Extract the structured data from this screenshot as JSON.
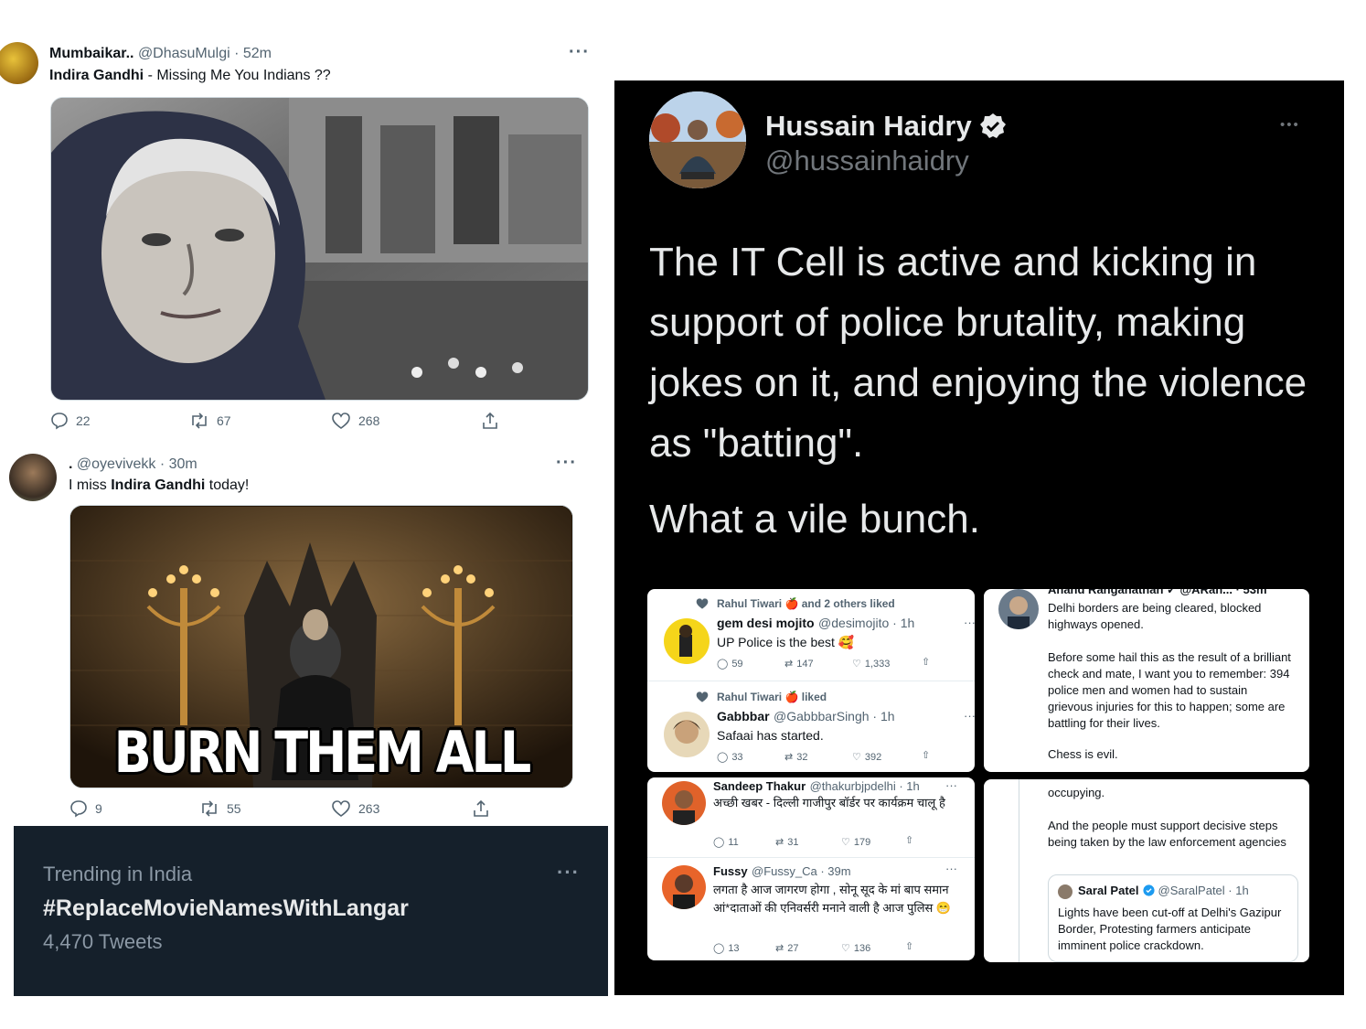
{
  "left": {
    "tweet1": {
      "name": "Mumbaikar..",
      "handle": "@DhasuMulgi · 52m",
      "text_bold": "Indira Gandhi",
      "text_rest": " - Missing Me You Indians ??",
      "replies": "22",
      "retweets": "67",
      "likes": "268"
    },
    "tweet2": {
      "name": ".",
      "handle": "@oyevivekk · 30m",
      "text_pre": "I miss ",
      "text_bold": "Indira Gandhi",
      "text_post": " today!",
      "meme_caption": "BURN THEM ALL",
      "replies": "9",
      "retweets": "55",
      "likes": "263"
    },
    "trending": {
      "label": "Trending in India",
      "tag": "#ReplaceMovieNamesWithLangar",
      "count": "4,470 Tweets"
    }
  },
  "right": {
    "author": {
      "name": "Hussain Haidry",
      "handle": "@hussainhaidry"
    },
    "body_p1": "The IT Cell is active and kicking in support of police brutality, making jokes on it, and enjoying the violence as \"batting\".",
    "body_p2": "What a vile bunch.",
    "shot1": [
      {
        "liked_by": "Rahul Tiwari 🍎 and 2 others liked",
        "name": "gem desi mojito",
        "handle": "@desimojito · 1h",
        "text": "UP Police is the best 🥰",
        "replies": "59",
        "retweets": "147",
        "likes": "1,333"
      },
      {
        "liked_by": "Rahul Tiwari 🍎 liked",
        "name": "Gabbbar",
        "handle": "@GabbbarSingh · 1h",
        "text": "Safaai has started.",
        "replies": "33",
        "retweets": "32",
        "likes": "392"
      }
    ],
    "shot2": {
      "header_cut": "Anand Ranganathan ✓ @ARan... · 53m",
      "p1": "Delhi borders are being cleared, blocked highways opened.",
      "p2": "Before some hail this as the result of a brilliant check and mate, I want you to remember: 394 police men and women had to sustain grievous injuries for this to happen; some are battling for their lives.",
      "p3": "Chess is evil."
    },
    "shot3": [
      {
        "name": "Sandeep Thakur",
        "handle": "@thakurbjpdelhi · 1h",
        "text": "अच्छी खबर - दिल्ली गाजीपुर बॉर्डर पर कार्यक्रम चालू है",
        "replies": "11",
        "retweets": "31",
        "likes": "179"
      },
      {
        "name": "Fussy",
        "handle": "@Fussy_Ca · 39m",
        "text": "लगता है आज जागरण होगा , सोनू सूद के मां बाप समान आं*दाताओं की एनिवर्सरी मनाने वाली है आज पुलिस 😁",
        "replies": "13",
        "retweets": "27",
        "likes": "136"
      }
    ],
    "shot4": {
      "p0": "occupying.",
      "p1": "And the people must support decisive steps being taken by the law enforcement agencies",
      "quote": {
        "name": "Saral Patel",
        "handle": "@SaralPatel · 1h",
        "text": "Lights have been cut-off at Delhi's Gazipur Border, Protesting farmers anticipate imminent police crackdown."
      }
    },
    "more_glyph": "•••"
  }
}
